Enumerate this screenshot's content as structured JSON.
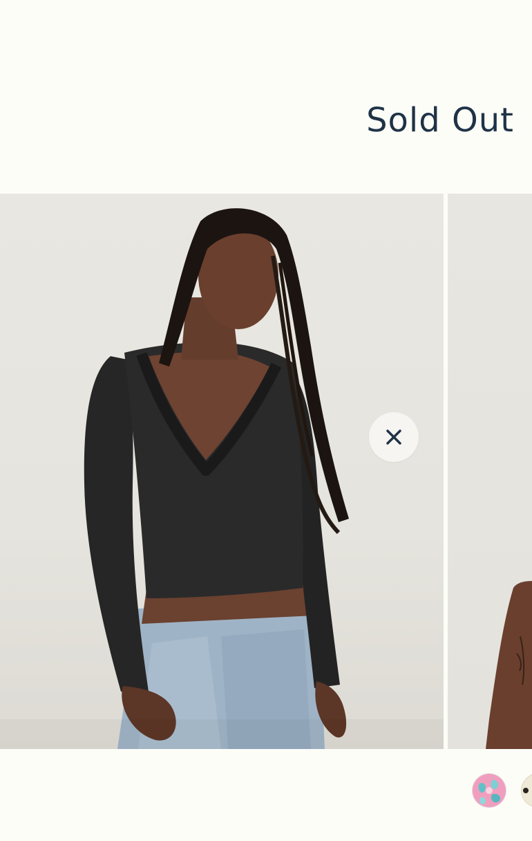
{
  "status": {
    "sold_out_label": "Sold Out"
  },
  "gallery": {
    "main_image_name": "model-black-lace-v-neck-top-photo",
    "next_image_name": "model-photo-partial"
  },
  "close_button": {
    "icon": "close-icon",
    "color": "#1f3346"
  },
  "swatches": [
    {
      "name": "pink-floral-print",
      "color": "#e99ab8",
      "selected": false
    },
    {
      "name": "cream-polka-dot",
      "color": "#efe9d7",
      "selected": false
    }
  ],
  "colors": {
    "background": "#fdfdf8",
    "text": "#1f3346"
  }
}
